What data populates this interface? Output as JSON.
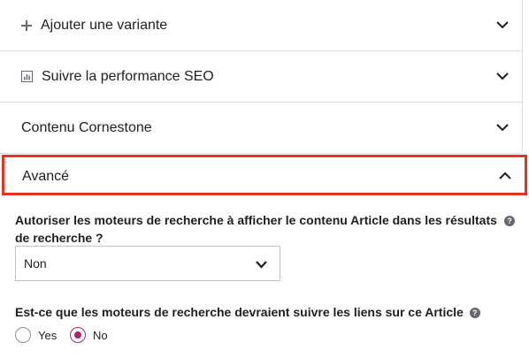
{
  "panels": [
    {
      "label": "Ajouter une variante",
      "icon": "plus-icon"
    },
    {
      "label": "Suivre la performance SEO",
      "icon": "chart-icon"
    },
    {
      "label": "Contenu Cornestone",
      "icon": ""
    }
  ],
  "advanced": {
    "label": "Avancé",
    "expanded": true,
    "highlight_color": "#e8321e"
  },
  "search_visibility": {
    "question_line1": "Autoriser les moteurs de recherche à afficher le contenu Article dans les résultats",
    "question_line2": "de recherche ?",
    "help": "?",
    "select_value": "Non"
  },
  "follow_links": {
    "question": "Est-ce que les moteurs de recherche devraient suivre les liens sur ce Article",
    "help": "?",
    "options": [
      {
        "label": "Yes",
        "checked": false
      },
      {
        "label": "No",
        "checked": true
      }
    ],
    "accent_color": "#a4286a"
  }
}
